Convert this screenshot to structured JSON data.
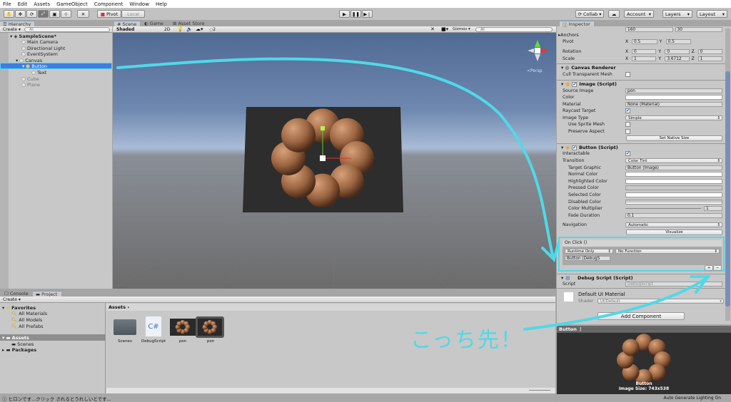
{
  "menu": [
    "File",
    "Edit",
    "Assets",
    "GameObject",
    "Component",
    "Window",
    "Help"
  ],
  "toolbar": {
    "pivot": "Pivot",
    "local": "Local",
    "collab": "Collab",
    "account": "Account",
    "layers": "Layers",
    "layout": "Layout"
  },
  "hierarchy": {
    "tab": "Hierarchy",
    "create": "Create",
    "search_placeholder": "All",
    "items": [
      "SampleScene*",
      "Main Camera",
      "Directional Light",
      "EventSystem",
      "Canvas",
      "Button",
      "Text",
      "Cube",
      "Plane"
    ]
  },
  "scene": {
    "tabs": [
      "Scene",
      "Game",
      "Asset Store"
    ],
    "shading": "Shaded",
    "mode2d": "2D",
    "gizmos": "Gizmos",
    "search_placeholder": "All",
    "persp": "Persp",
    "layers_count": "2"
  },
  "inspector": {
    "tab": "Inspector",
    "size_w": "160",
    "size_h": "30",
    "anchors": "Anchors",
    "pivot": {
      "label": "Pivot",
      "x": "0.5",
      "y": "0.5"
    },
    "rotation": {
      "label": "Rotation",
      "x": "0",
      "y": "0",
      "z": "0"
    },
    "scale": {
      "label": "Scale",
      "x": "1",
      "y": "3.6712",
      "z": "1"
    },
    "canvas_renderer": {
      "title": "Canvas Renderer",
      "cull": "Cull Transparent Mesh",
      "cull_checked": false
    },
    "image": {
      "title": "Image (Script)",
      "source_label": "Source Image",
      "source": "pon",
      "color": "Color",
      "material_label": "Material",
      "material": "None (Material)",
      "raycast": "Raycast Target",
      "raycast_checked": true,
      "type_label": "Image Type",
      "type": "Simple",
      "sprite_mesh": "Use Sprite Mesh",
      "preserve": "Preserve Aspect",
      "native": "Set Native Size"
    },
    "button": {
      "title": "Button (Script)",
      "interactable": "Interactable",
      "interactable_checked": true,
      "transition_label": "Transition",
      "transition": "Color Tint",
      "target_label": "Target Graphic",
      "target": "Button (Image)",
      "normal": "Normal Color",
      "highlighted": "Highlighted Color",
      "pressed": "Pressed Color",
      "selected": "Selected Color",
      "disabled": "Disabled Color",
      "multiplier_label": "Color Multiplier",
      "multiplier": "1",
      "fade_label": "Fade Duration",
      "fade": "0.1",
      "nav_label": "Navigation",
      "nav": "Automatic",
      "visualize": "Visualize"
    },
    "onclick": {
      "title": "On Click ()",
      "runtime": "Runtime Only",
      "function": "No Function",
      "object": "Button (DebugS",
      "plus": "+",
      "minus": "−"
    },
    "debug": {
      "title": "Debug Script (Script)",
      "script_label": "Script",
      "script": "DebugScript"
    },
    "material": {
      "title": "Default UI Material",
      "shader_label": "Shader",
      "shader": "UI/Default"
    },
    "add_component": "Add Component"
  },
  "project": {
    "tabs": [
      "Console",
      "Project"
    ],
    "create": "Create",
    "favorites": "Favorites",
    "fav_items": [
      "All Materials",
      "All Models",
      "All Prefabs"
    ],
    "assets": "Assets",
    "scenes": "Scenes",
    "packages": "Packages",
    "breadcrumb": "Assets",
    "files": [
      "Scenes",
      "DebugScript",
      "pon",
      "pon"
    ]
  },
  "status": "ヒロンです...クリック されるとうれしいとです...",
  "preview": {
    "title": "Button",
    "name": "Button",
    "size": "Image Size: 743x538",
    "lighting": "Auto Generate Lighting On"
  },
  "annotation": {
    "text": "こっち先！",
    "color": "#4fd9e8"
  },
  "colors": {
    "selection": "#3e7ce6",
    "accent": "#4fd9e8"
  }
}
